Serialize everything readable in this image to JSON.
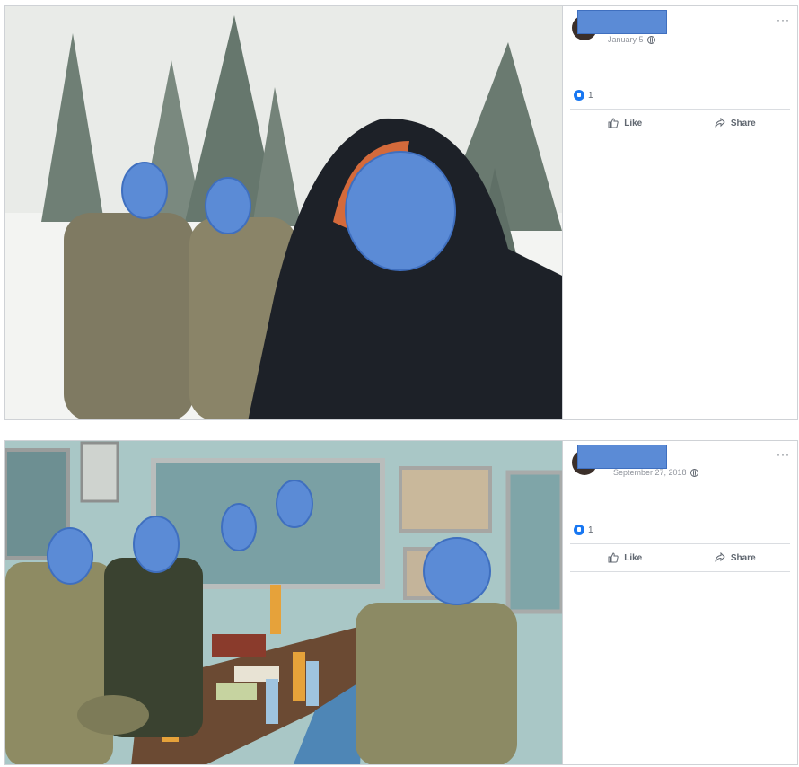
{
  "posts": [
    {
      "date": "January 5",
      "reaction_count": "1",
      "actions": {
        "like": "Like",
        "share": "Share"
      },
      "menu": "···"
    },
    {
      "date": "September 27, 2018",
      "reaction_count": "1",
      "actions": {
        "like": "Like",
        "share": "Share"
      },
      "menu": "···"
    }
  ],
  "icons": [
    "globe-icon",
    "like-reaction-icon",
    "like-thumb-icon",
    "share-arrow-icon",
    "more-options-icon"
  ],
  "colors": {
    "redaction": "#5b8bd6",
    "like_blue": "#1877f2",
    "meta_gray": "#90949c",
    "text_gray": "#606770"
  }
}
